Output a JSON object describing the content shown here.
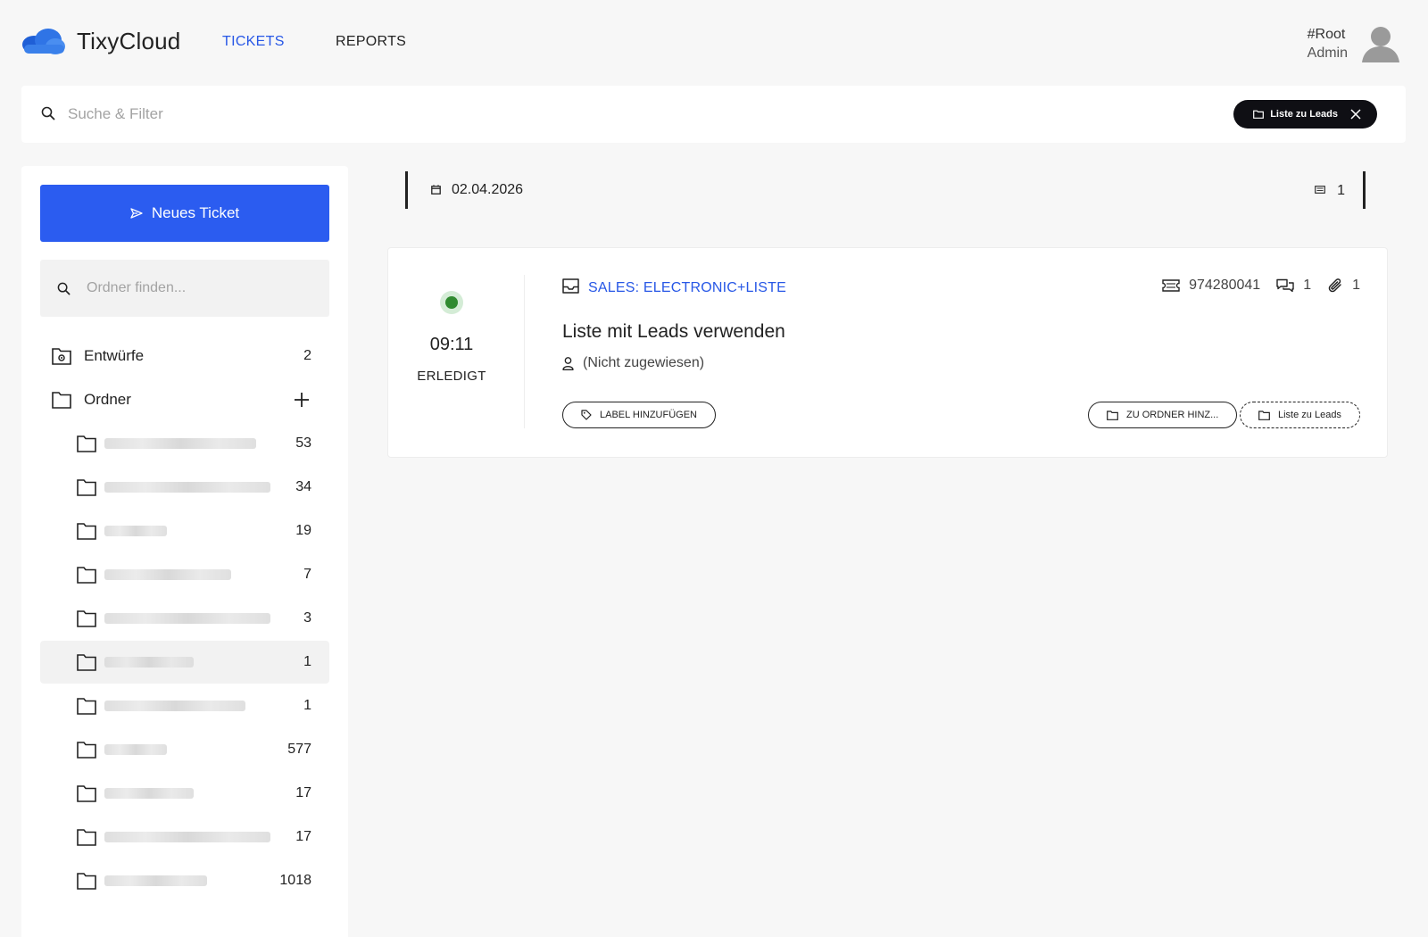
{
  "app": {
    "name": "TixyCloud",
    "brand_color": "#2b5cf0"
  },
  "nav": {
    "tickets": "TICKETS",
    "reports": "REPORTS"
  },
  "user": {
    "name": "#Root",
    "role": "Admin"
  },
  "search": {
    "placeholder": "Suche & Filter",
    "active_filter": "Liste zu Leads"
  },
  "sidebar": {
    "new_ticket": "Neues Ticket",
    "folder_search_placeholder": "Ordner finden...",
    "drafts": {
      "label": "Entwürfe",
      "count": "2"
    },
    "folders_label": "Ordner",
    "folders": [
      {
        "count": "53"
      },
      {
        "count": "34"
      },
      {
        "count": "19"
      },
      {
        "count": "7"
      },
      {
        "count": "3"
      },
      {
        "count": "1",
        "selected": true
      },
      {
        "count": "1"
      },
      {
        "count": "577"
      },
      {
        "count": "17"
      },
      {
        "count": "17"
      },
      {
        "count": "1018"
      }
    ]
  },
  "main": {
    "date": "02.04.2026",
    "ticket_count": "1",
    "ticket": {
      "status_color": "#2f8a2f",
      "time": "09:11",
      "status": "ERLEDIGT",
      "queue": "SALES: ELECTRONIC+LISTE",
      "number": "974280041",
      "comments": "1",
      "attachments": "1",
      "subject": "Liste mit Leads verwenden",
      "assignee": "(Nicht zugewiesen)",
      "add_label": "LABEL HINZUFÜGEN",
      "add_folder": "ZU ORDNER HINZ...",
      "folder_tag": "Liste zu Leads"
    }
  }
}
